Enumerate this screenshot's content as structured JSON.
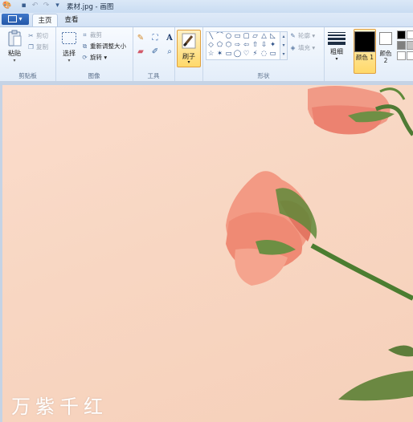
{
  "window": {
    "title": "素材.jpg - 画图"
  },
  "tabs": [
    {
      "label": "主页",
      "active": true
    },
    {
      "label": "查看",
      "active": false
    }
  ],
  "file_menu": {
    "label": "▾"
  },
  "ribbon": {
    "clipboard": {
      "group_label": "剪贴板",
      "paste_label": "粘贴",
      "cut_label": "剪切",
      "copy_label": "复制"
    },
    "image": {
      "group_label": "图像",
      "select_label": "选择",
      "crop_label": "裁剪",
      "resize_label": "重新调整大小",
      "rotate_label": "旋转"
    },
    "tools": {
      "group_label": "工具",
      "text_tool": "A"
    },
    "brush": {
      "label": "刷子"
    },
    "shapes": {
      "group_label": "形状",
      "outline_label": "轮廓",
      "fill_label": "填充",
      "glyphs": [
        "╲",
        "⌒",
        "○",
        "▭",
        "▢",
        "▱",
        "△",
        "◺",
        "◇",
        "⬠",
        "⬡",
        "⇨",
        "⇦",
        "⇧",
        "⇩",
        "✦",
        "☆",
        "✶",
        "▭",
        "◯",
        "♡",
        "⚡",
        "◌",
        "▭"
      ]
    },
    "size": {
      "label": "粗细"
    },
    "colors": {
      "color1_label": "颜色 1",
      "color2_label": "颜色 2",
      "color1": "#000000",
      "color2": "#ffffff",
      "palette": [
        "#000000",
        "#ffffff",
        "#7f7f7f",
        "#c3c3c3",
        "#ffffff",
        "#ffffff"
      ]
    }
  },
  "image": {
    "description_colors": {
      "background": "#f8d7c3",
      "petal": "#f08878",
      "stem": "#5a8a3a"
    },
    "watermark": "万紫千红"
  }
}
